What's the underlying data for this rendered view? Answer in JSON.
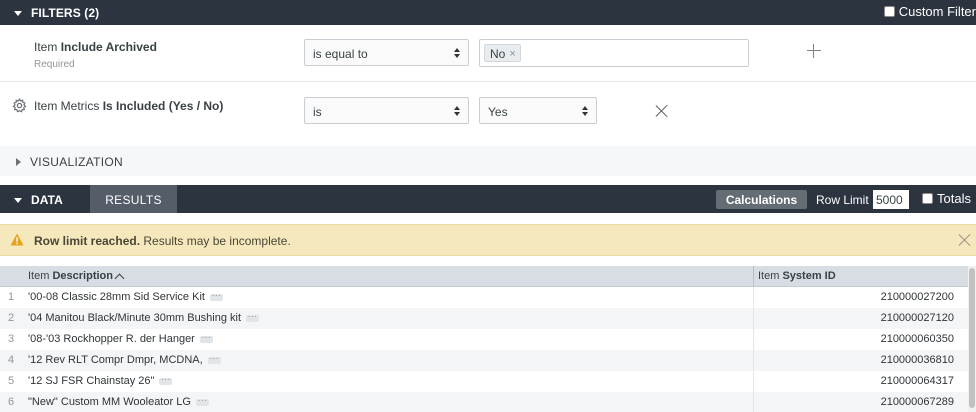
{
  "filters": {
    "title": "FILTERS (2)",
    "custom_filter_label": "Custom Filter",
    "rows": [
      {
        "label_prefix": "Item",
        "label_field": "Include Archived",
        "sublabel": "Required",
        "operator": "is equal to",
        "value_chip": "No",
        "chip_remove": "×"
      },
      {
        "label_prefix": "Item Metrics",
        "label_field": "Is Included (Yes / No)",
        "operator": "is",
        "value": "Yes"
      }
    ]
  },
  "visualization": {
    "title": "VISUALIZATION"
  },
  "data_bar": {
    "title": "DATA",
    "tab_results": "RESULTS",
    "calculations_label": "Calculations",
    "row_limit_label": "Row Limit",
    "row_limit_value": "5000",
    "totals_label": "Totals"
  },
  "warning": {
    "bold": "Row limit reached.",
    "text": "Results may be incomplete."
  },
  "table": {
    "col1_prefix": "Item",
    "col1_field": "Description",
    "col2_prefix": "Item",
    "col2_field": "System ID",
    "rows": [
      {
        "n": "1",
        "desc": "'00-08 Classic 28mm Sid Service Kit",
        "id": "210000027200"
      },
      {
        "n": "2",
        "desc": "'04 Manitou Black/Minute 30mm Bushing kit",
        "id": "210000027120"
      },
      {
        "n": "3",
        "desc": "'08-'03 Rockhopper R. der Hanger",
        "id": "210000060350"
      },
      {
        "n": "4",
        "desc": "'12 Rev RLT Compr Dmpr, MCDNA,",
        "id": "210000036810"
      },
      {
        "n": "5",
        "desc": "'12 SJ FSR Chainstay 26\"",
        "id": "210000064317"
      },
      {
        "n": "6",
        "desc": "\"New\" Custom MM Wooleator LG",
        "id": "210000067289"
      }
    ]
  },
  "colors": {
    "bar_dark": "#2c3440",
    "warning_bg": "#f5e8bd",
    "header_bg": "#d7dde3"
  },
  "icons": {
    "gear": "gear-icon",
    "plus": "plus-icon",
    "close": "close-icon",
    "warning": "warning-icon"
  }
}
